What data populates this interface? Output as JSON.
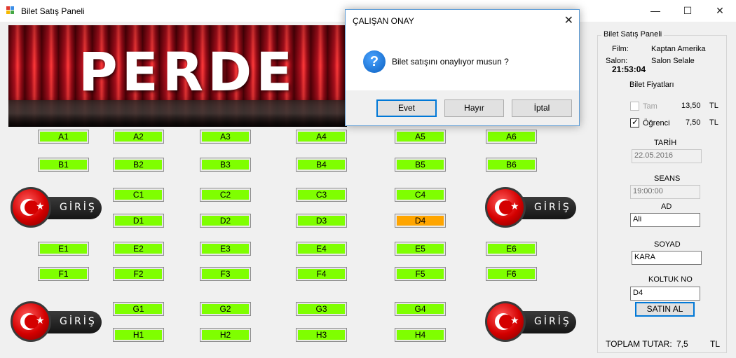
{
  "window": {
    "title": "Bilet Satış Paneli",
    "minimize": "—",
    "maximize": "☐",
    "close": "✕"
  },
  "banner": {
    "text": "PERDE"
  },
  "seats": [
    "A1",
    "A2",
    "A3",
    "A4",
    "A5",
    "A6",
    "B1",
    "B2",
    "B3",
    "B4",
    "B5",
    "B6",
    "C1",
    "C2",
    "C3",
    "C4",
    "D1",
    "D2",
    "D3",
    "D4",
    "E1",
    "E2",
    "E3",
    "E4",
    "E5",
    "E6",
    "F1",
    "F2",
    "F3",
    "F4",
    "F5",
    "F6",
    "G1",
    "G2",
    "G3",
    "G4",
    "H1",
    "H2",
    "H3",
    "H4"
  ],
  "selected_seat": "D4",
  "entrance_label": "GİRİŞ",
  "panel": {
    "group_title": "Bilet Satış Paneli",
    "film_label": "Film:",
    "film_value": "Kaptan Amerika",
    "salon_label": "Salon:",
    "salon_value": "Salon Selale",
    "clock": "21:53:04",
    "prices_title": "Bilet Fiyatları",
    "tam_label": "Tam",
    "tam_price": "13,50",
    "tam_checked": false,
    "ogrenci_label": "Öğrenci",
    "ogrenci_price": "7,50",
    "ogrenci_checked": true,
    "currency": "TL",
    "tarih_label": "TARİH",
    "tarih_value": "22.05.2016",
    "seans_label": "SEANS",
    "seans_value": "19:00:00",
    "ad_label": "AD",
    "ad_value": "Ali",
    "soyad_label": "SOYAD",
    "soyad_value": "KARA",
    "koltuk_label": "KOLTUK NO",
    "koltuk_value": "D4",
    "buy_button": "SATIN AL",
    "total_label": "TOPLAM TUTAR:",
    "total_value": "7,5",
    "total_currency": "TL"
  },
  "dialog": {
    "title": "ÇALIŞAN ONAY",
    "close": "✕",
    "icon": "question-icon",
    "message": "Bilet satışını onaylıyor musun ?",
    "yes": "Evet",
    "no": "Hayır",
    "cancel": "İptal"
  }
}
